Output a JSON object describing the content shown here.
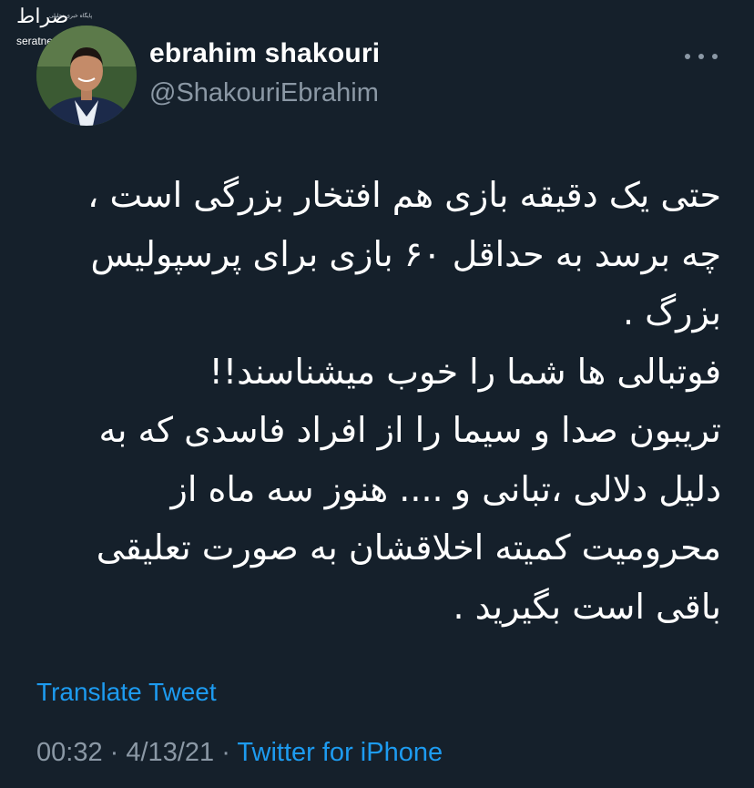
{
  "watermark": {
    "logo": "صراط",
    "tagline": "پایگاه خبری تحلیلی",
    "site": "seratnews.ir"
  },
  "user": {
    "display_name": "ebrahim shakouri",
    "handle": "@ShakouriEbrahim"
  },
  "tweet": {
    "lines": [
      "حتی یک دقیقه بازی هم  افتخار بزرگی است ،",
      "چه برسد به حداقل ۶۰ بازی برای پرسپولیس",
      "بزرگ .",
      "فوتبالی ها شما را خوب میشناسند!!",
      "تریبون صدا و سیما را از افراد فاسدی که به",
      "دلیل دلالی ،تبانی و .... هنوز سه ماه از",
      "محرومیت کمیته اخلاقشان به صورت تعلیقی",
      "باقی است بگیرید ."
    ],
    "translate_label": "Translate Tweet",
    "time": "00:32",
    "date": "4/13/21",
    "separator": "·",
    "source": "Twitter for iPhone"
  },
  "colors": {
    "background": "#15202b",
    "text": "#ffffff",
    "secondary": "#8b98a5",
    "accent": "#1d9bf0"
  },
  "icons": {
    "more": "more-horizontal-icon"
  }
}
